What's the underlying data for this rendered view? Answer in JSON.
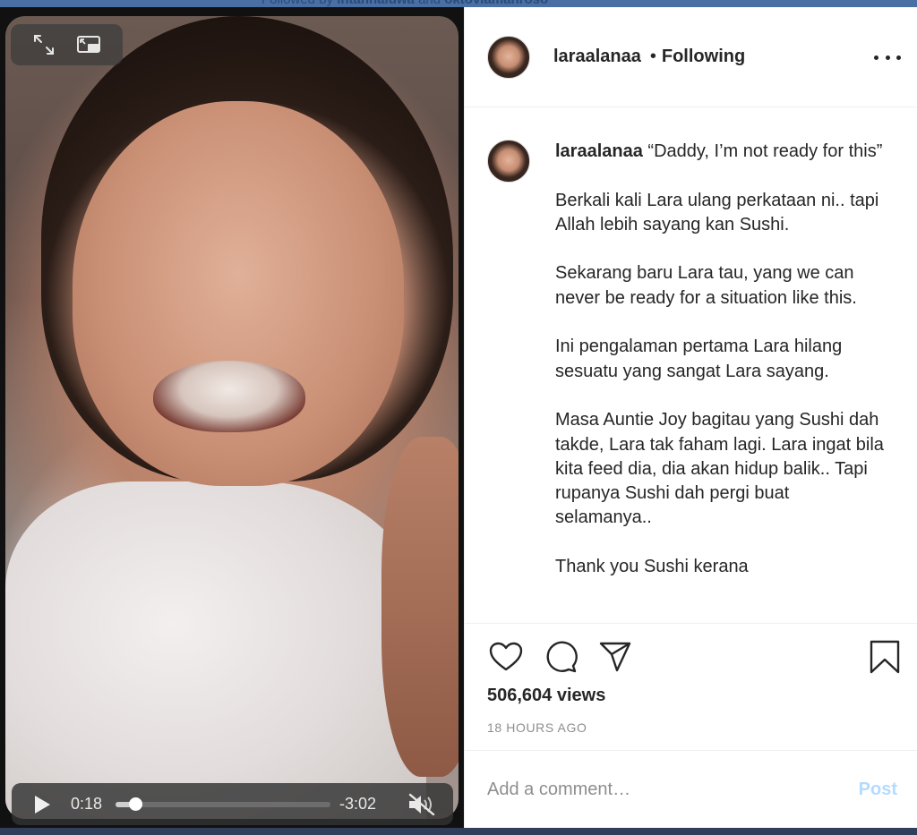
{
  "background": {
    "followed_by_prefix": "Followed by",
    "followed_by_user1": "intannaiuwa",
    "followed_by_and": "and",
    "followed_by_user2": "oktoviamanroso"
  },
  "video": {
    "current_time": "0:18",
    "remaining_time": "-3:02",
    "progress_fraction": 0.09,
    "muted": true
  },
  "post": {
    "username": "laraalanaa",
    "separator": "•",
    "follow_status": "Following",
    "caption": {
      "username": "laraalanaa",
      "paragraphs": [
        "“Daddy, I’m not ready for this”",
        "Berkali kali Lara ulang perkataan ni.. tapi Allah lebih sayang kan Sushi.",
        "Sekarang baru Lara tau, yang we can never be ready for a situation like this.",
        "Ini pengalaman pertama Lara hilang sesuatu yang sangat Lara sayang.",
        "Masa Auntie Joy bagitau yang Sushi dah takde, Lara tak faham lagi. Lara ingat bila kita feed dia, dia akan hidup balik.. Tapi rupanya Sushi dah pergi buat selamanya..",
        "Thank you Sushi kerana"
      ]
    },
    "views": "506,604 views",
    "timestamp": "18 HOURS AGO",
    "comment_placeholder": "Add a comment…",
    "post_button": "Post"
  }
}
